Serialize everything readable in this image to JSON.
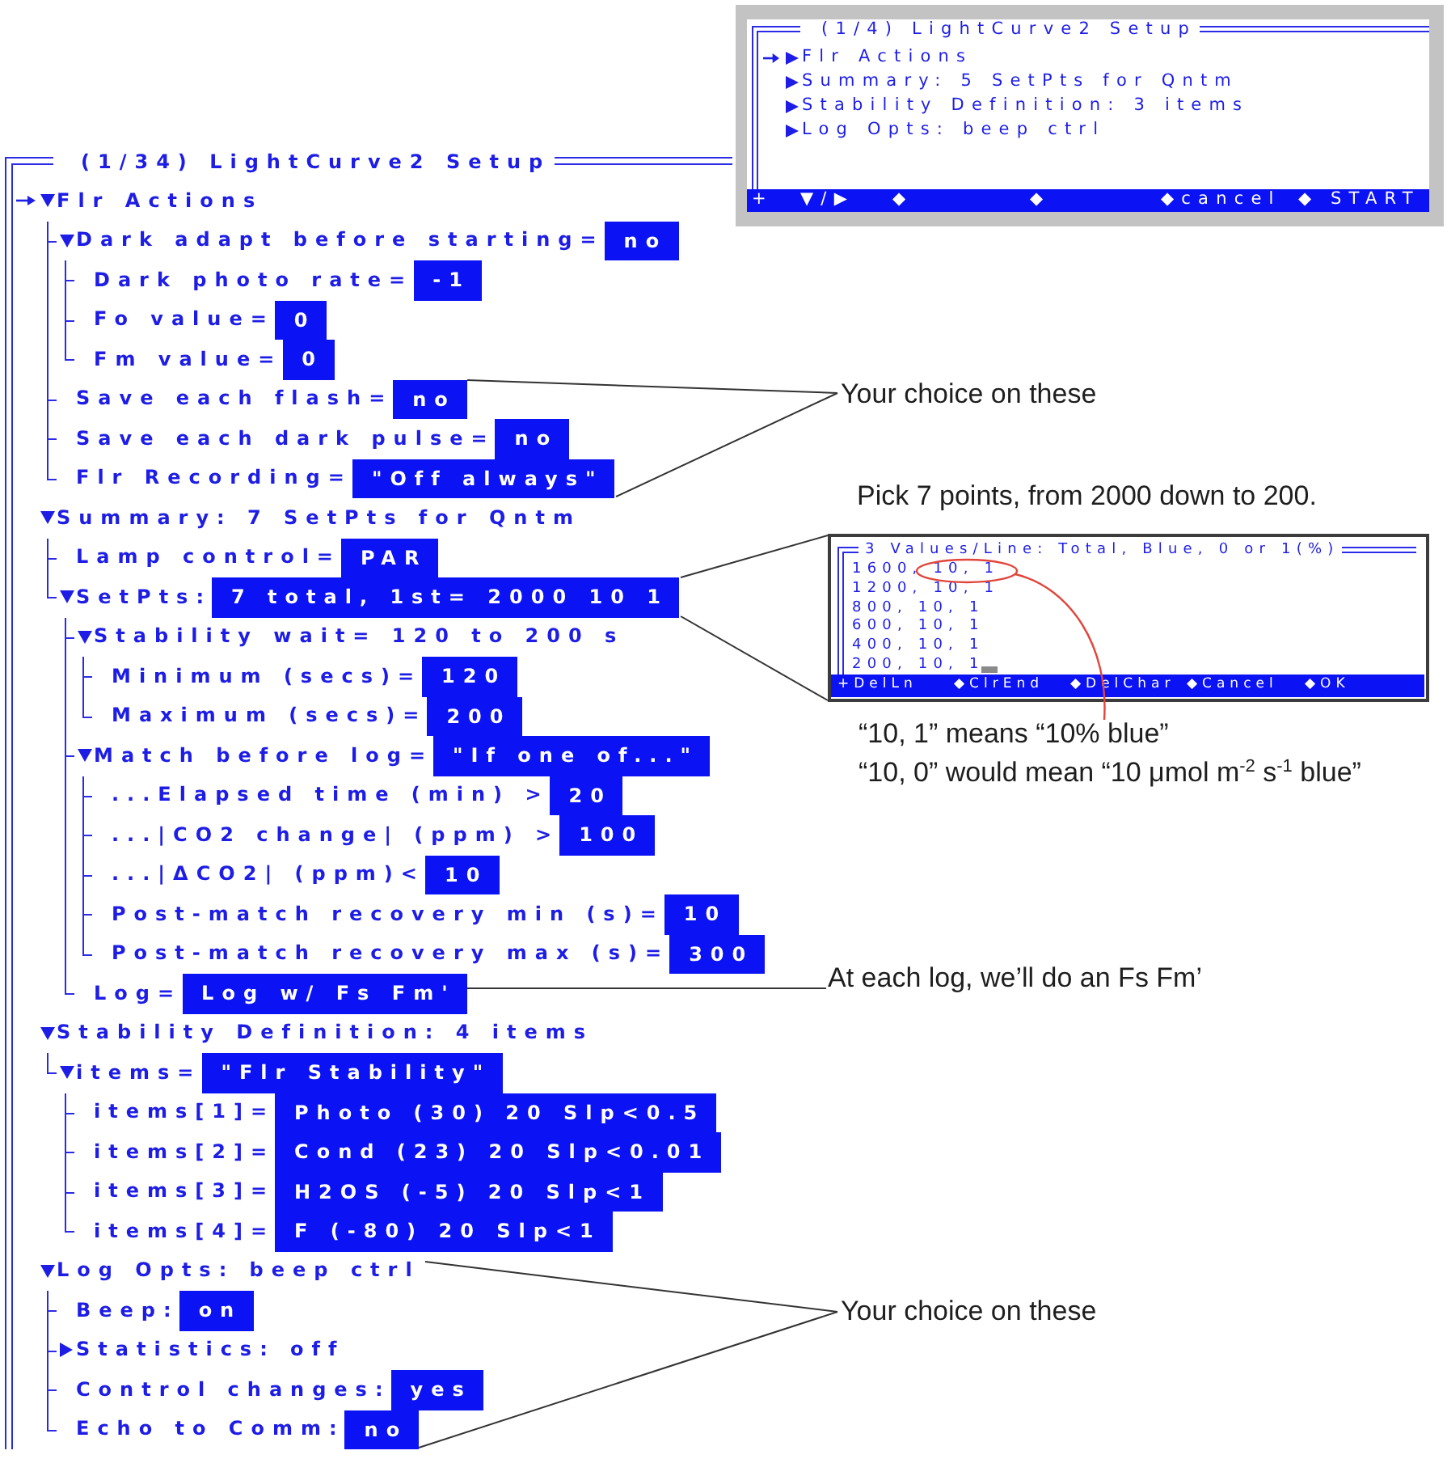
{
  "overview_screen": {
    "title": "(1/4) LightCurve2 Setup",
    "items": [
      {
        "label": "Flr Actions",
        "selected": true,
        "expanded": false
      },
      {
        "label": "Summary: 5 SetPts for Qntm",
        "selected": false,
        "expanded": false
      },
      {
        "label": "Stability Definition: 3 items",
        "selected": false,
        "expanded": false
      },
      {
        "label": "Log Opts: beep ctrl",
        "selected": false,
        "expanded": false
      }
    ],
    "function_keys": [
      "+",
      "▼/▶",
      "◆",
      "◆",
      "◆cancel",
      "◆",
      "START"
    ]
  },
  "setup_screen": {
    "title": "(1/34) LightCurve2 Setup",
    "items": [
      {
        "label": "Flr Actions",
        "selected": true,
        "expanded": true,
        "children": [
          {
            "label": "Dark adapt before starting=",
            "value": "no",
            "expanded": true,
            "children": [
              {
                "label": "Dark photo rate=",
                "value": "-1"
              },
              {
                "label": "Fo value=",
                "value": "0"
              },
              {
                "label": "Fm value=",
                "value": "0"
              }
            ]
          },
          {
            "label": "Save each flash=",
            "value": "no"
          },
          {
            "label": "Save each dark pulse=",
            "value": "no"
          },
          {
            "label": "Flr Recording=",
            "value": "\"Off always\""
          }
        ]
      },
      {
        "label": "Summary: 7 SetPts for Qntm",
        "selected": false,
        "expanded": true,
        "children": [
          {
            "label": "Lamp control=",
            "value": "PAR"
          },
          {
            "label": "SetPts:",
            "value": "7 total, 1st= 2000 10 1",
            "expanded": true,
            "children": [
              {
                "label": "Stability wait= 120 to 200 s",
                "expanded": true,
                "children": [
                  {
                    "label": "Minimum (secs)=",
                    "value": "120"
                  },
                  {
                    "label": "Maximum (secs)=",
                    "value": "200"
                  }
                ]
              },
              {
                "label": "Match before log=",
                "value": "\"If one of...\"",
                "expanded": true,
                "children": [
                  {
                    "label": "...Elapsed time (min) >",
                    "value": "20"
                  },
                  {
                    "label": "...|CO2 change| (ppm) >",
                    "value": "100"
                  },
                  {
                    "label": "...|ΔCO2| (ppm)<",
                    "value": "10"
                  },
                  {
                    "label": "Post-match recovery min (s)=",
                    "value": "10"
                  },
                  {
                    "label": "Post-match recovery max (s)=",
                    "value": "300"
                  }
                ]
              },
              {
                "label": "Log=",
                "value": "Log w/ Fs Fm'"
              }
            ]
          }
        ]
      },
      {
        "label": "Stability Definition: 4 items",
        "selected": false,
        "expanded": true,
        "children": [
          {
            "label": "items=",
            "value": "\"Flr Stability\"",
            "expanded": true,
            "children": [
              {
                "label": "items[1]=",
                "value": "Photo (30) 20 Slp<0.5"
              },
              {
                "label": "items[2]=",
                "value": "Cond (23) 20 Slp<0.01"
              },
              {
                "label": "items[3]=",
                "value": "H2OS (-5) 20 Slp<1"
              },
              {
                "label": "items[4]=",
                "value": "F (-80) 20 Slp<1"
              }
            ]
          }
        ]
      },
      {
        "label": "Log Opts: beep ctrl",
        "selected": false,
        "expanded": true,
        "children": [
          {
            "label": "Beep:",
            "value": "on"
          },
          {
            "label": "Statistics: off",
            "expanded": false
          },
          {
            "label": "Control changes:",
            "value": "yes"
          },
          {
            "label": "Echo to Comm:",
            "value": "no"
          }
        ]
      }
    ]
  },
  "callouts": [
    {
      "kind": "note",
      "text": "Your choice on these"
    },
    {
      "kind": "note",
      "text": "Pick 7 points, from 2000 down to 200."
    },
    {
      "kind": "editor",
      "title": "3 Values/Line: Total, Blue, 0 or 1(%)",
      "lines": [
        {
          "text": "1600, 10, 1",
          "cursor": false
        },
        {
          "text": "1200, 10, 1",
          "cursor": false
        },
        {
          "text": "800, 10, 1",
          "cursor": false
        },
        {
          "text": "600, 10, 1",
          "cursor": false
        },
        {
          "text": "400, 10, 1",
          "cursor": false
        },
        {
          "text": "200, 10, 1",
          "cursor": true
        }
      ],
      "function_keys": [
        "+DelLn",
        "◆ClrEnd",
        "◆DelChar",
        "◆Cancel",
        "◆OK"
      ]
    },
    {
      "kind": "note",
      "text": "“10, 1” means “10% blue”"
    },
    {
      "kind": "note",
      "text": "“10, 0” would mean “10 μmol m$^{-2}$ s$^{-1}$ blue”"
    },
    {
      "kind": "note",
      "text": "At each log, we’ll do an Fs Fm’"
    },
    {
      "kind": "note",
      "text": "Your choice on these"
    }
  ]
}
